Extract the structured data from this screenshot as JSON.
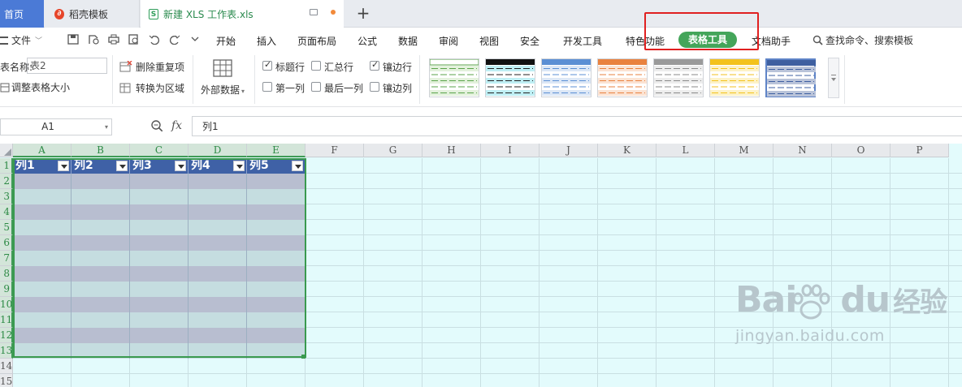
{
  "tabs": {
    "home": "首页",
    "template": "稻壳模板",
    "document": "新建 XLS 工作表.xls",
    "add": "+"
  },
  "menu": {
    "file": "文件",
    "items": [
      "开始",
      "插入",
      "页面布局",
      "公式",
      "数据",
      "审阅",
      "视图",
      "安全",
      "开发工具",
      "特色功能",
      "表格工具",
      "文档助手"
    ],
    "search": "查找命令、搜索模板"
  },
  "ribbon": {
    "table_name_label": "表名称:",
    "table_name_value": "表2",
    "resize_table": "调整表格大小",
    "remove_duplicates": "删除重复项",
    "convert_to_range": "转换为区域",
    "external_data": "外部数据",
    "checkboxes": {
      "header_row": {
        "label": "标题行",
        "checked": true
      },
      "total_row": {
        "label": "汇总行",
        "checked": false
      },
      "banded_rows": {
        "label": "镶边行",
        "checked": true
      },
      "first_column": {
        "label": "第一列",
        "checked": false
      },
      "last_column": {
        "label": "最后一列",
        "checked": false
      },
      "banded_columns": {
        "label": "镶边列",
        "checked": false
      }
    },
    "styles": [
      "green",
      "black",
      "blue",
      "orange",
      "gray",
      "yellow",
      "dark-blue"
    ]
  },
  "formula_bar": {
    "cell_ref": "A1",
    "fx": "fx",
    "content": "列1"
  },
  "sheet": {
    "columns": [
      "A",
      "B",
      "C",
      "D",
      "E",
      "F",
      "G",
      "H",
      "I",
      "J",
      "K",
      "L",
      "M",
      "N",
      "O",
      "P"
    ],
    "rows": [
      "1",
      "2",
      "3",
      "4",
      "5",
      "6",
      "7",
      "8",
      "9",
      "10",
      "11",
      "12",
      "13",
      "14",
      "15"
    ],
    "table_headers": [
      "列1",
      "列2",
      "列3",
      "列4",
      "列5"
    ]
  },
  "watermark": {
    "brand": "Bai",
    "brand2": "du",
    "cn": "经验",
    "url": "jingyan.baidu.com"
  },
  "colors": {
    "header_blue": "#3f61a6",
    "band_dark": "#b8bed0",
    "band_light": "#c5dde0",
    "sheet_bg": "#e3fbfc",
    "table_tools_green": "#44a55a",
    "highlight_red": "#e02020"
  }
}
